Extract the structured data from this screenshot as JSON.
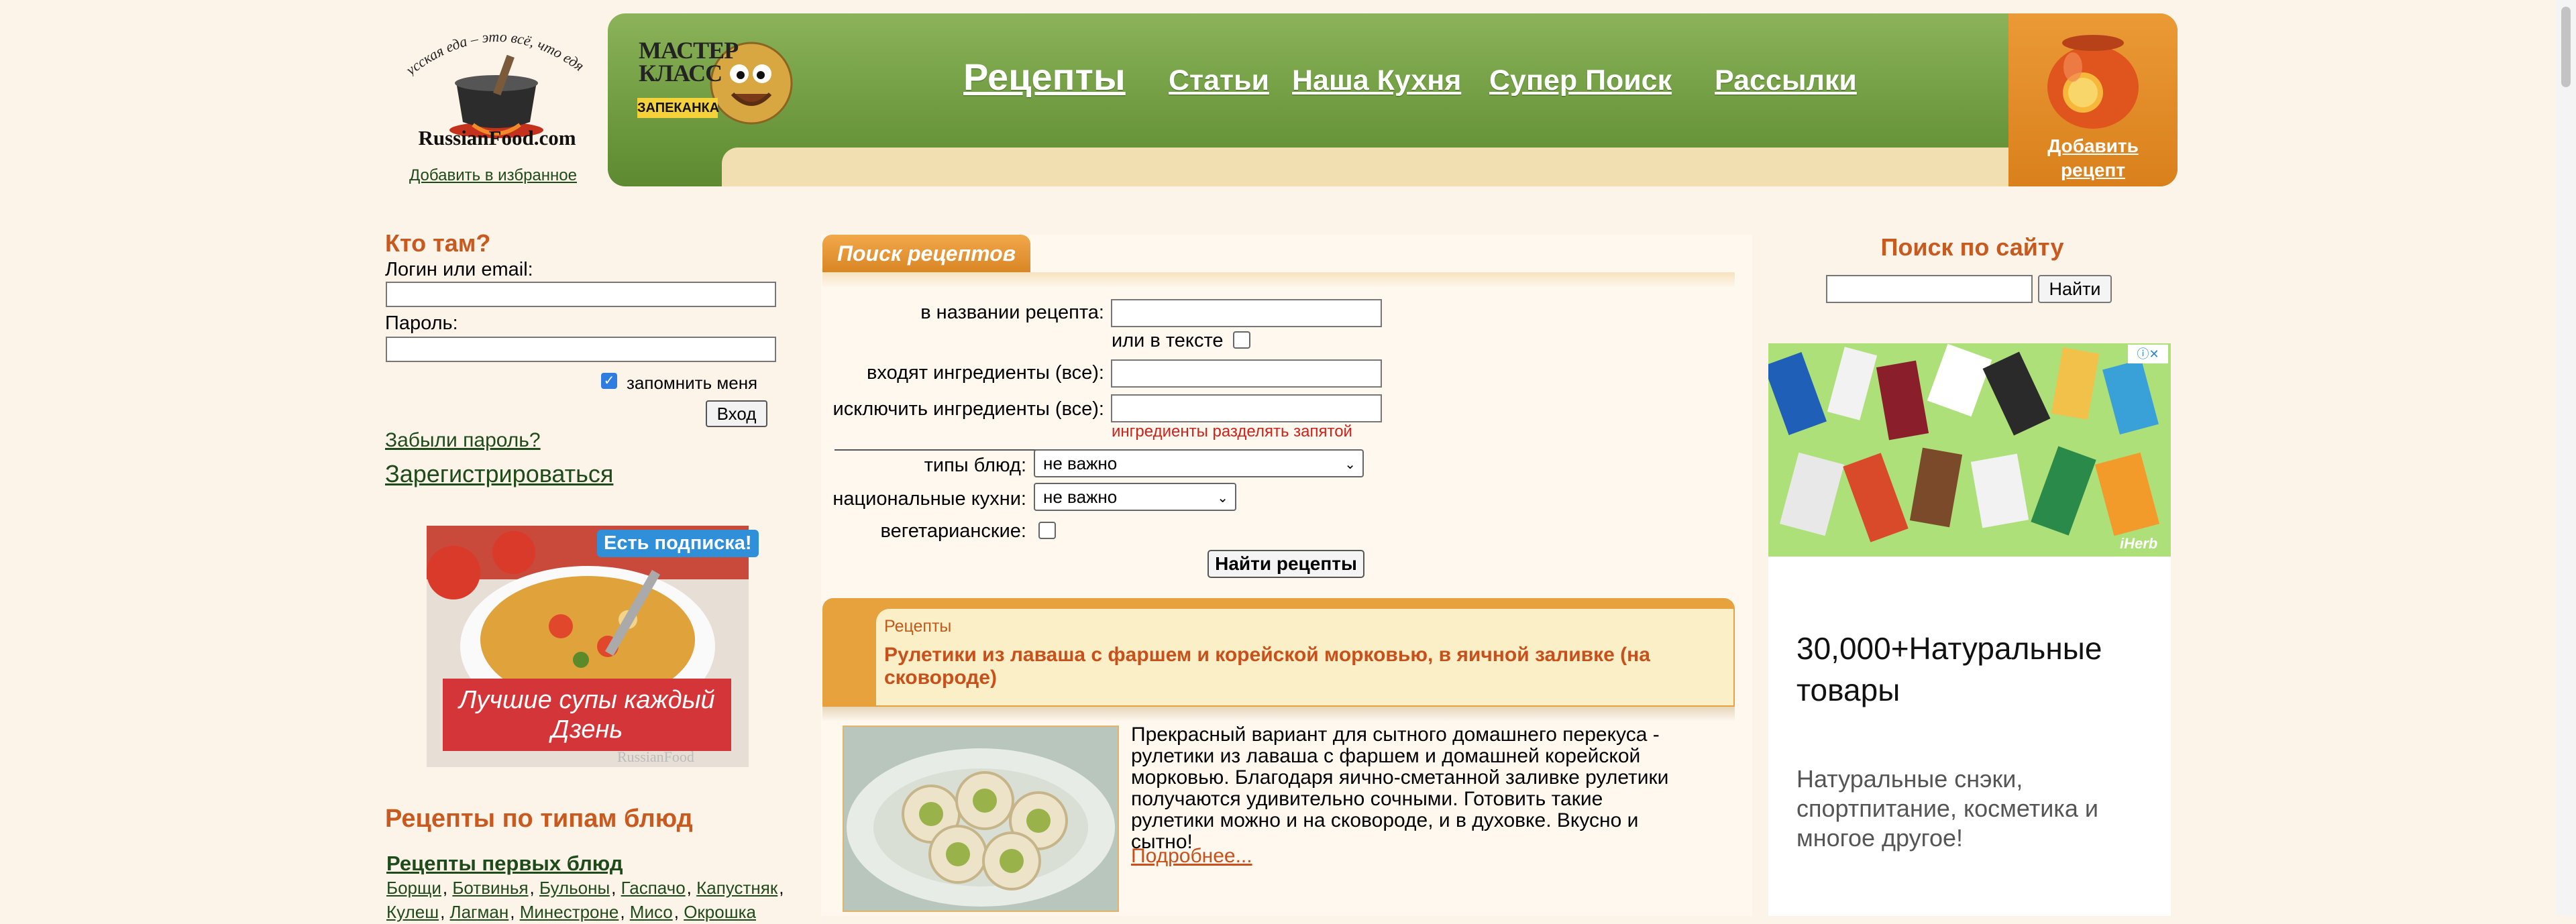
{
  "header": {
    "logo_tagline": "Русская еда – это всё, что едят!",
    "logo_text": "RussianFood.com",
    "add_favorites": "Добавить в избранное",
    "masterclass_line1": "МАСТЕР",
    "masterclass_line2": "КЛАСС",
    "masterclass_badge": "ЗАПЕКАНКА",
    "nav": [
      "Рецепты",
      "Статьи",
      "Наша Кухня",
      "Супер Поиск",
      "Рассылки"
    ],
    "add_recipe": "Добавить рецепт"
  },
  "login": {
    "title": "Кто там?",
    "login_label": "Логин или email:",
    "login_value": "",
    "password_label": "Пароль:",
    "password_value": "",
    "remember_label": "запомнить меня",
    "remember_checked": true,
    "submit": "Вход",
    "forgot": "Забыли пароль?",
    "register": "Зарегистрироваться"
  },
  "ad_soup": {
    "badge": "Есть подписка!",
    "text": "Лучшие супы каждый Дзень",
    "watermark": "RussianFood"
  },
  "dish_types": {
    "title": "Рецепты по типам блюд",
    "first_dishes": "Рецепты первых блюд",
    "links": [
      "Борщи",
      "Ботвинья",
      "Бульоны",
      "Гаспачо",
      "Капустняк",
      "Кулеш",
      "Лагман",
      "Минестроне",
      "Мисо",
      "Окрошка"
    ]
  },
  "search_form": {
    "tab": "Поиск рецептов",
    "name_label": "в названии рецепта:",
    "name_value": "",
    "in_text_label": "или в тексте",
    "include_label": "входят ингредиенты (все):",
    "include_value": "",
    "exclude_label": "исключить ингредиенты (все):",
    "exclude_value": "",
    "hint": "ингредиенты разделять запятой",
    "types_label": "типы блюд:",
    "types_value": "не важно",
    "cuisine_label": "национальные кухни:",
    "cuisine_value": "не важно",
    "veg_label": "вегетарианские:",
    "submit": "Найти рецепты"
  },
  "recipe": {
    "category": "Рецепты",
    "title": "Рулетики из лаваша с фаршем и корейской морковью, в яичной заливке (на сковороде)",
    "description": "Прекрасный вариант для сытного домашнего перекуса - рулетики из лаваша с фаршем и домашней корейской морковью. Благодаря яично-сметанной заливке рулетики получаются удивительно сочными. Готовить такие рулетики можно и на сковороде, и в духовке. Вкусно и сытно!",
    "more": "Подробнее..."
  },
  "site_search": {
    "title": "Поиск по сайту",
    "value": "",
    "button": "Найти"
  },
  "ad_right": {
    "headline": "30,000+Натуральные товары",
    "subtext": "Натуральные снэки, спортпитание, косметика и многое другое!",
    "brand": "iHerb"
  },
  "colors": {
    "accent_green": "#75a045",
    "accent_orange": "#d9801c",
    "title_orange": "#c85a20",
    "page_bg": "#fdf4e9"
  }
}
